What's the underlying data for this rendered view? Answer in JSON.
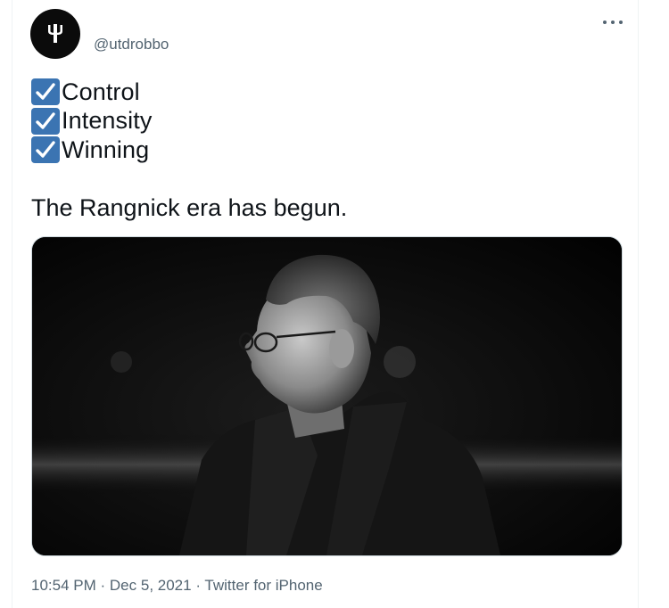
{
  "tweet": {
    "handle": "@utdrobbo",
    "checklist": [
      {
        "label": "Control",
        "checked": true
      },
      {
        "label": "Intensity",
        "checked": true
      },
      {
        "label": "Winning",
        "checked": true
      }
    ],
    "text": "The Rangnick era has begun.",
    "time": "10:54 PM",
    "separator": "·",
    "date": "Dec 5, 2021",
    "source": "Twitter for iPhone"
  },
  "icons": {
    "avatar": "trident-logo-icon",
    "more": "more-options-icon",
    "check": "checkmark-icon"
  },
  "colors": {
    "checkbox": "#3b74b2",
    "muted_text": "#536471",
    "text": "#0f1419"
  }
}
